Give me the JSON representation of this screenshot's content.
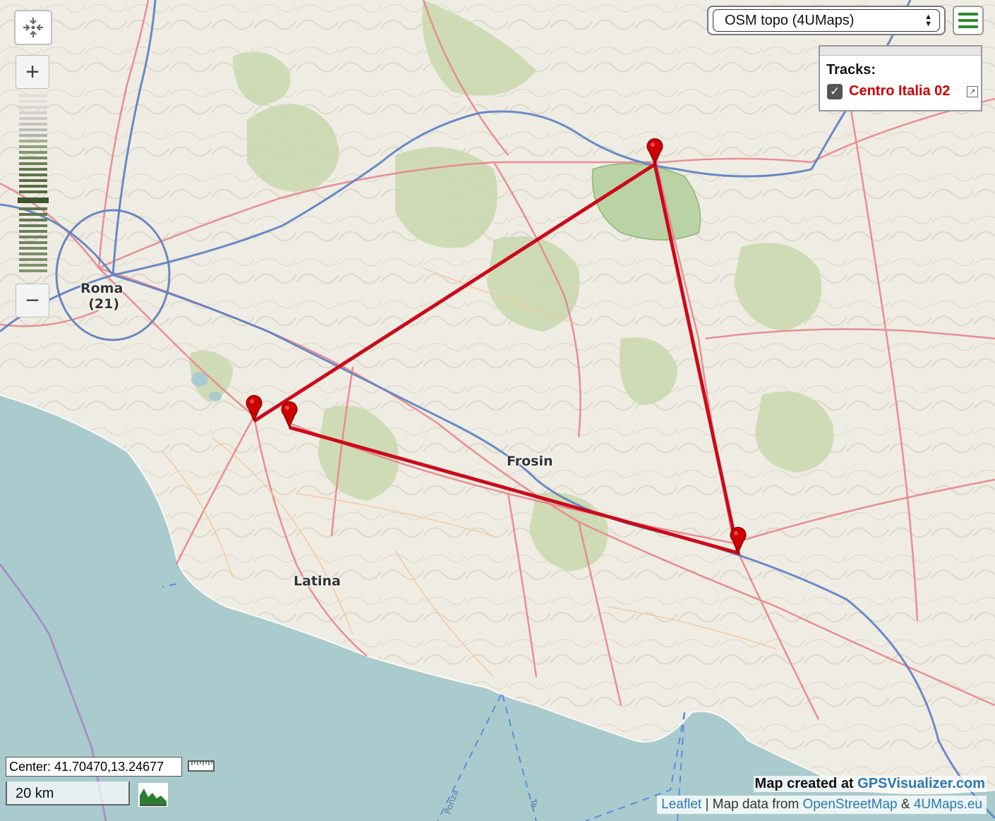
{
  "map": {
    "place_labels": [
      {
        "name": "Roma",
        "sub": "(21)"
      },
      {
        "name": "Frosin"
      },
      {
        "name": "Latina"
      }
    ],
    "road_labels": [
      "Ponza",
      "Te"
    ],
    "colors": {
      "track": "#cc0a1a",
      "sea": "#aacbcd",
      "land": "#f2efe6",
      "river": "#5a7fc4",
      "road": "#e8848c"
    },
    "markers": 4
  },
  "controls": {
    "locate_icon": "locate-icon",
    "zoom_in_label": "+",
    "zoom_out_label": "−"
  },
  "layer_select": {
    "selected": "OSM topo (4UMaps)"
  },
  "menu_icon": "hamburger-menu-icon",
  "tracks_panel": {
    "title": "Tracks:",
    "items": [
      {
        "name": "Centro Italia 02",
        "checked": true,
        "color": "#cc0000"
      }
    ]
  },
  "status": {
    "center": "Center: 41.70470,13.24677",
    "scale": "20 km"
  },
  "credits": {
    "created_prefix": "Map created at ",
    "created_site": "GPSVisualizer.com",
    "leaflet": "Leaflet",
    "sep": " | Map data from ",
    "osm": "OpenStreetMap",
    "amp": " & ",
    "fourumaps": "4UMaps.eu"
  }
}
